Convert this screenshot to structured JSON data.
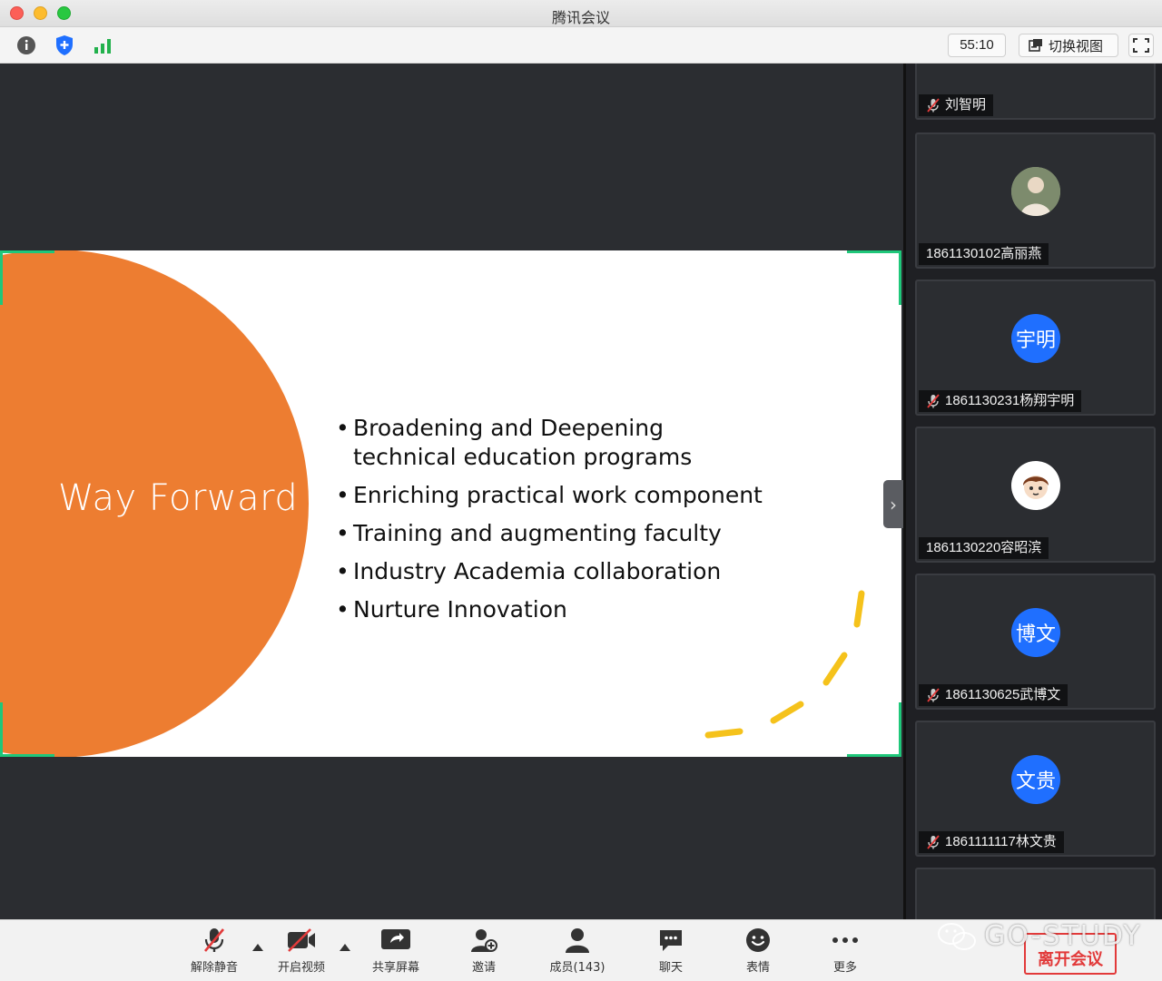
{
  "window": {
    "title": "腾讯会议"
  },
  "toolbar": {
    "timer": "55:10",
    "switch_view_label": "切换视图",
    "info_icon": "info-icon",
    "security_icon": "shield-icon",
    "signal_icon": "signal-bars-icon"
  },
  "slide": {
    "title": "Way Forward",
    "bullets": [
      "Broadening and Deepening technical education programs",
      "Enriching practical work component",
      "Training and augmenting faculty",
      "Industry Academia collaboration",
      "Nurture Innovation"
    ],
    "accent_color": "#ed7d31",
    "dash_color": "#f5c21b",
    "frame_color": "#1fc77a"
  },
  "participants": [
    {
      "label": "刘智明",
      "muted": true,
      "avatar_text": "",
      "avatar_color": ""
    },
    {
      "label": "1861130102高丽燕",
      "muted": false,
      "avatar_text": "",
      "avatar_color": "#8a9a7a"
    },
    {
      "label": "1861130231杨翔宇明",
      "muted": true,
      "avatar_text": "宇明",
      "avatar_color": "#1f6fff"
    },
    {
      "label": "1861130220容昭滨",
      "muted": false,
      "avatar_text": "",
      "avatar_color": "#ffffff"
    },
    {
      "label": "1861130625武博文",
      "muted": true,
      "avatar_text": "博文",
      "avatar_color": "#1f6fff"
    },
    {
      "label": "1861111117林文贵",
      "muted": true,
      "avatar_text": "文贵",
      "avatar_color": "#1f6fff"
    }
  ],
  "controls": {
    "unmute": "解除静音",
    "start_video": "开启视频",
    "share_screen": "共享屏幕",
    "invite": "邀请",
    "members": "成员(143)",
    "chat": "聊天",
    "reactions": "表情",
    "more": "更多",
    "leave": "离开会议"
  },
  "watermark": {
    "text": "GO-STUDY"
  }
}
